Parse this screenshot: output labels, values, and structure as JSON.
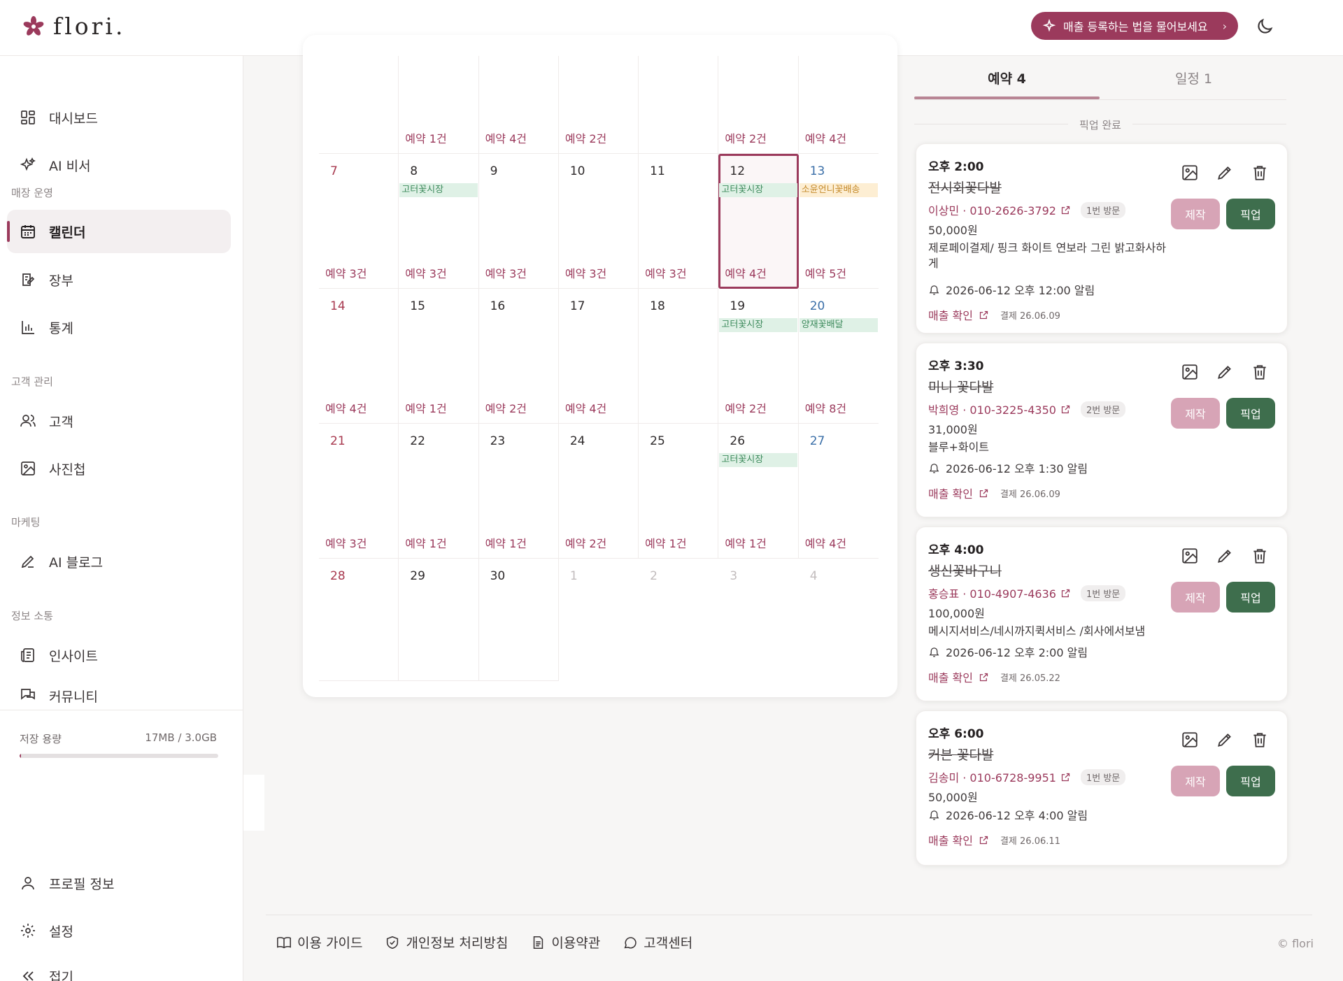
{
  "brand": {
    "name": "flori."
  },
  "header": {
    "ai_prompt": "매출 등록하는 법을 물어보세요"
  },
  "sidebar": {
    "items_top": [
      {
        "label": "대시보드",
        "icon": "dashboard-icon"
      },
      {
        "label": "AI 비서",
        "icon": "sparkle-icon"
      }
    ],
    "sections": [
      {
        "label": "매장 운영",
        "items": [
          {
            "label": "캘린더",
            "icon": "calendar-icon",
            "active": true
          },
          {
            "label": "장부",
            "icon": "ledger-icon"
          },
          {
            "label": "통계",
            "icon": "chart-icon"
          }
        ]
      },
      {
        "label": "고객 관리",
        "items": [
          {
            "label": "고객",
            "icon": "users-icon"
          },
          {
            "label": "사진첩",
            "icon": "image-icon"
          }
        ]
      },
      {
        "label": "마케팅",
        "items": [
          {
            "label": "AI 블로그",
            "icon": "pen-icon"
          }
        ]
      },
      {
        "label": "정보 소통",
        "items": [
          {
            "label": "인사이트",
            "icon": "newspaper-icon"
          },
          {
            "label": "커뮤니티",
            "icon": "chat-icon"
          }
        ]
      }
    ],
    "storage": {
      "label": "저장 용량",
      "value": "17MB / 3.0GB",
      "used_fraction": 0.006
    },
    "bottom_items": [
      {
        "label": "프로필 정보",
        "icon": "user-icon"
      },
      {
        "label": "설정",
        "icon": "gear-icon"
      },
      {
        "label": "접기",
        "icon": "collapse-icon"
      }
    ]
  },
  "calendar": {
    "rows": [
      [
        {
          "day": "",
          "count": ""
        },
        {
          "day": "",
          "count": "예약 1건"
        },
        {
          "day": "",
          "count": "예약 4건"
        },
        {
          "day": "",
          "count": "예약 2건"
        },
        {
          "day": "",
          "count": ""
        },
        {
          "day": "",
          "count": "예약 2건"
        },
        {
          "day": "",
          "count": "예약 4건"
        }
      ],
      [
        {
          "day": "7",
          "count": "예약 3건"
        },
        {
          "day": "8",
          "count": "예약 3건",
          "chip": "고터꽃시장",
          "chip_color": "green"
        },
        {
          "day": "9",
          "count": "예약 3건"
        },
        {
          "day": "10",
          "count": "예약 3건"
        },
        {
          "day": "11",
          "count": "예약 3건"
        },
        {
          "day": "12",
          "count": "예약 4건",
          "chip": "고터꽃시장",
          "chip_color": "green",
          "selected": true
        },
        {
          "day": "13",
          "count": "예약 5건",
          "chip": "소윤언니꽃배송",
          "chip_color": "yellow"
        }
      ],
      [
        {
          "day": "14",
          "count": "예약 4건"
        },
        {
          "day": "15",
          "count": "예약 1건"
        },
        {
          "day": "16",
          "count": "예약 2건"
        },
        {
          "day": "17",
          "count": "예약 4건"
        },
        {
          "day": "18",
          "count": ""
        },
        {
          "day": "19",
          "count": "예약 2건",
          "chip": "고터꽃시장",
          "chip_color": "green"
        },
        {
          "day": "20",
          "count": "예약 8건",
          "chip": "양재꽃배달",
          "chip_color": "green"
        }
      ],
      [
        {
          "day": "21",
          "count": "예약 3건"
        },
        {
          "day": "22",
          "count": "예약 1건"
        },
        {
          "day": "23",
          "count": "예약 1건"
        },
        {
          "day": "24",
          "count": "예약 2건"
        },
        {
          "day": "25",
          "count": "예약 1건"
        },
        {
          "day": "26",
          "count": "예약 1건",
          "chip": "고터꽃시장",
          "chip_color": "green"
        },
        {
          "day": "27",
          "count": "예약 4건"
        }
      ],
      [
        {
          "day": "28",
          "count": ""
        },
        {
          "day": "29",
          "count": ""
        },
        {
          "day": "30",
          "count": ""
        },
        {
          "day": "1",
          "count": "",
          "other": true
        },
        {
          "day": "2",
          "count": "",
          "other": true
        },
        {
          "day": "3",
          "count": "",
          "other": true
        },
        {
          "day": "4",
          "count": "",
          "other": true
        }
      ]
    ]
  },
  "panel": {
    "tabs": [
      {
        "label": "예약 4",
        "active": true
      },
      {
        "label": "일정 1"
      }
    ],
    "group_label": "픽업 완료",
    "make_label": "제작",
    "pick_label": "픽업",
    "sale_label": "매출 확인",
    "reservations": [
      {
        "time": "오후 2:00",
        "title": "전시회꽃다발",
        "customer": "이상민 · 010-2626-3792",
        "visit": "1번 방문",
        "price": "50,000원",
        "note": "제로페이결제/ 핑크 화이트 연보라 그린 밝고화사하게",
        "alarm": "2026-06-12 오후 12:00 알림",
        "paid": "결제 26.06.09"
      },
      {
        "time": "오후 3:30",
        "title": "미니 꽃다발",
        "customer": "박희영 · 010-3225-4350",
        "visit": "2번 방문",
        "price": "31,000원",
        "note": "블루+화이트",
        "alarm": "2026-06-12 오후 1:30 알림",
        "paid": "결제 26.06.09"
      },
      {
        "time": "오후 4:00",
        "title": "생신꽃바구니",
        "customer": "홍승표 · 010-4907-4636",
        "visit": "1번 방문",
        "price": "100,000원",
        "note": "메시지서비스/네시까지퀵서비스 /회사에서보냄",
        "alarm": "2026-06-12 오후 2:00 알림",
        "paid": "결제 26.05.22"
      },
      {
        "time": "오후 6:00",
        "title": "커븐 꽃다발",
        "customer": "김송미 · 010-6728-9951",
        "visit": "1번 방문",
        "price": "50,000원",
        "note": "",
        "alarm": "2026-06-12 오후 4:00 알림",
        "paid": "결제 26.06.11"
      }
    ]
  },
  "footer": {
    "links": [
      {
        "label": "이용 가이드",
        "icon": "book-icon"
      },
      {
        "label": "개인정보 처리방침",
        "icon": "shield-icon"
      },
      {
        "label": "이용약관",
        "icon": "document-icon"
      },
      {
        "label": "고객센터",
        "icon": "chat-bubble-icon"
      }
    ],
    "copyright": "© flori"
  },
  "colors": {
    "accent": "#9b3a5c",
    "pickup": "#3e6e4d",
    "make": "#d7a4b6"
  }
}
